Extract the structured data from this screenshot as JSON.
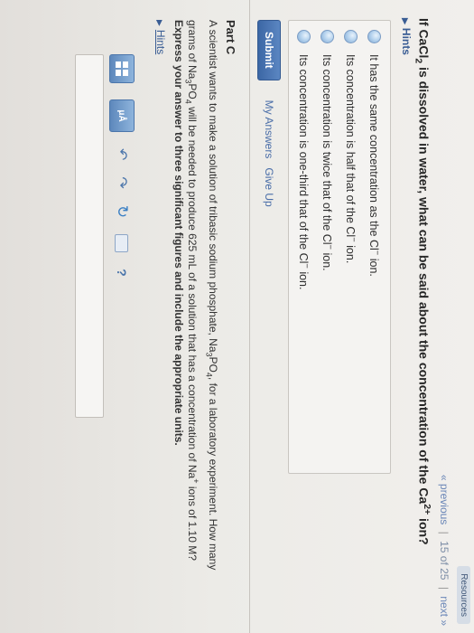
{
  "topbar": {
    "resources_label": "Resources"
  },
  "nav": {
    "previous_label": "« previous",
    "separator": "|",
    "counter": "15 of 25",
    "next_label": "next »"
  },
  "part_b": {
    "question_prefix": "If CaCl",
    "question_sub": "2",
    "question_mid": " is dissolved in water, what can be said about the concentration of the Ca",
    "question_sup": "2+",
    "question_suffix": " ion?",
    "hints_label": "Hints",
    "options": [
      {
        "pre": "It has the same concentration as the Cl",
        "sup": "−",
        "post": " ion."
      },
      {
        "pre": "Its concentration is half that of the Cl",
        "sup": "−",
        "post": " ion."
      },
      {
        "pre": "Its concentration is twice that of the Cl",
        "sup": "−",
        "post": " ion."
      },
      {
        "pre": "Its concentration is one-third that of the Cl",
        "sup": "−",
        "post": " ion."
      }
    ],
    "submit_label": "Submit",
    "my_answers_label": "My Answers",
    "give_up_label": "Give Up"
  },
  "part_c": {
    "title": "Part C",
    "text_1": "A scientist wants to make a solution of tribasic sodium phosphate, Na",
    "text_sub1": "3",
    "text_2": "PO",
    "text_sub2": "4",
    "text_3": ", for a laboratory experiment. How many grams of Na",
    "text_sub3": "3",
    "text_4": "PO",
    "text_sub4": "4",
    "text_5": " will be needed to produce 625 mL of a solution that has a concentration of Na",
    "text_sup5": "+",
    "text_6": " ions of 1.10 M?",
    "instructions": "Express your answer to three significant figures and include the appropriate units.",
    "hints_label": "Hints",
    "toolbar": {
      "units_label": "μÅ",
      "help_label": "?"
    }
  }
}
